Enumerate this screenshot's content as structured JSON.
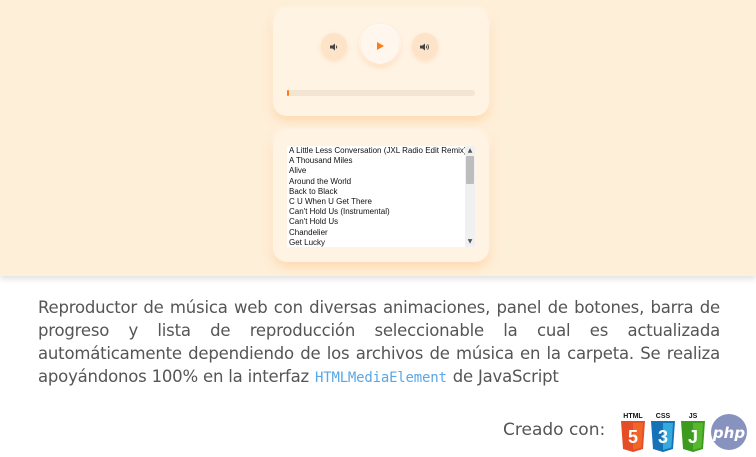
{
  "player": {
    "vol_down_icon": "volume-down-icon",
    "play_icon": "play-icon",
    "vol_up_icon": "volume-up-icon",
    "progress": 0.01,
    "accent": "#ff7a1a"
  },
  "playlist": {
    "items": [
      "A Little Less Conversation (JXL Radio Edit Remix)",
      "A Thousand Miles",
      "Alive",
      "Around the World",
      "Back to Black",
      "C U When U Get There",
      "Can't Hold Us (Instrumental)",
      "Can't Hold Us",
      "Chandelier",
      "Get Lucky"
    ]
  },
  "description": {
    "text_before": "Reproductor de música web con diversas animaciones, panel de botones, barra de progreso y lista de reproducción seleccionable la cual es actualizada automáticamente dependiendo de los archivos de música en la carpeta. Se realiza apoyándonos 100% en la interfaz",
    "code": "HTMLMediaElement",
    "text_after": "de JavaScript"
  },
  "footer": {
    "created_label": "Creado con:",
    "logos": [
      {
        "label": "HTML",
        "num": "5",
        "color": "#e44d26"
      },
      {
        "label": "CSS",
        "num": "3",
        "color": "#1572b6"
      },
      {
        "label": "JS",
        "num": "J",
        "color": "#3c9a1f"
      },
      {
        "label": "",
        "num": "php",
        "color": "#7a86b8"
      }
    ]
  }
}
